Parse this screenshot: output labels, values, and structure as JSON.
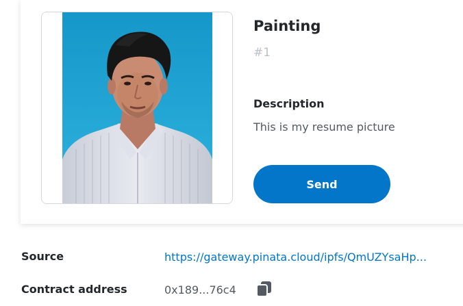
{
  "nft": {
    "title": "Painting",
    "id_label": "#1",
    "description_heading": "Description",
    "description_text": "This is my resume picture",
    "image_alt": "resume portrait photo"
  },
  "actions": {
    "send_label": "Send"
  },
  "details": {
    "source_label": "Source",
    "source_value": "https://gateway.pinata.cloud/ipfs/QmUZYsaHp...",
    "contract_label": "Contract address",
    "contract_value": "0x189...76c4",
    "copy_icon": "copy-icon"
  },
  "colors": {
    "accent": "#0376c9",
    "heading": "#24272a",
    "muted": "#bbc0c5",
    "body_text": "#535a61",
    "photo_background": "#1a9fd0"
  }
}
